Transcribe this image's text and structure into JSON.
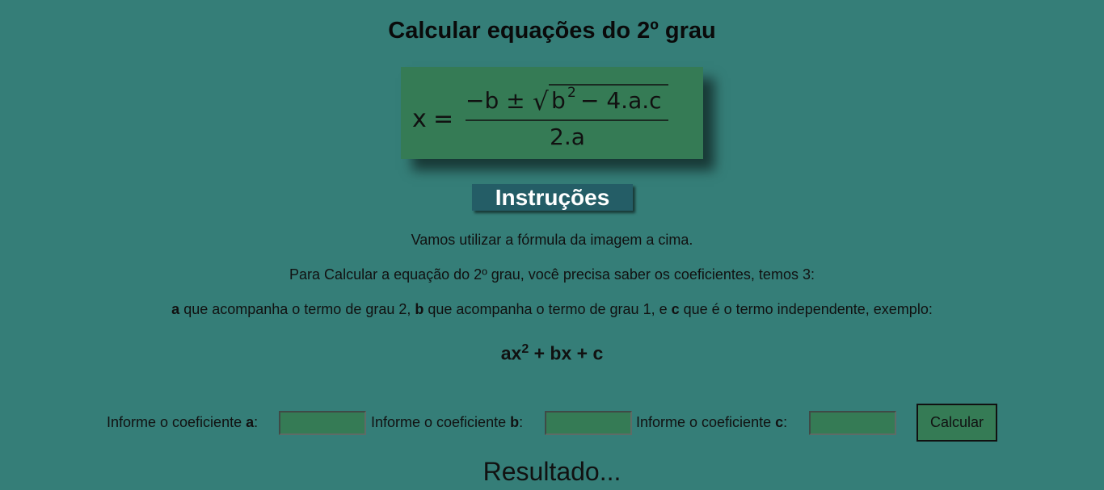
{
  "page": {
    "title": "Calcular equações do 2º grau"
  },
  "formula": {
    "lhs": "x",
    "equals": "=",
    "numerator_prefix": "−b ±",
    "radical": "√",
    "radicand_base": "b",
    "radicand_exp": "2",
    "radicand_rest": "− 4.a.c",
    "denominator": "2.a"
  },
  "instructions": {
    "button_label": "Instruções",
    "line1": "Vamos utilizar a fórmula da imagem a cima.",
    "line2": "Para Calcular a equação do 2º grau, você precisa saber os coeficientes, temos 3:",
    "line3": {
      "a_bold": "a",
      "a_text": " que acompanha o termo de grau 2, ",
      "b_bold": "b",
      "b_text": " que acompanha o termo de grau 1, e ",
      "c_bold": "c",
      "c_text": " que é o termo independente, exemplo:"
    },
    "example": {
      "base": "ax",
      "exp": "2",
      "rest": " + bx + c"
    }
  },
  "form": {
    "label_prefix": "Informe o coeficiente ",
    "a_letter": "a",
    "b_letter": "b",
    "c_letter": "c",
    "colon": ":",
    "a_value": "",
    "b_value": "",
    "c_value": "",
    "calculate_label": "Calcular"
  },
  "result": {
    "text": "Resultado..."
  },
  "colors": {
    "background": "#357e78",
    "formula_box": "#357b55",
    "instructions_button": "#245d66",
    "input_fill": "#357b55"
  }
}
